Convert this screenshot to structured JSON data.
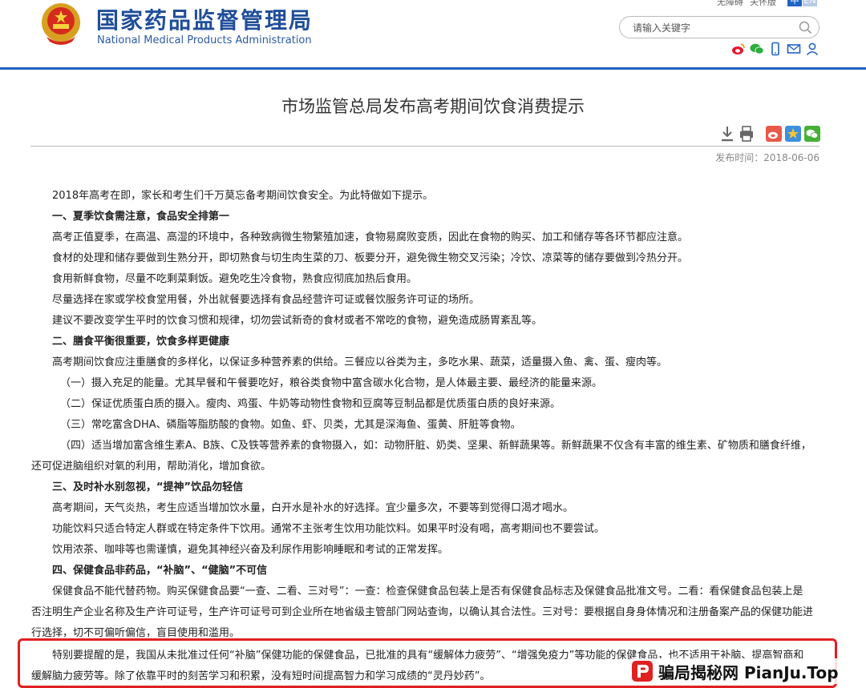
{
  "header": {
    "site_name_cn": "国家药品监督管理局",
    "site_name_en": "National Medical Products Administration",
    "util_links": [
      "无障碍",
      "关怀版"
    ],
    "lang_cn": "中",
    "lang_en": "EN",
    "search_placeholder": "请输入关键字",
    "social_icons": [
      "weibo-icon",
      "wechat-icon",
      "mobile-icon",
      "mail-icon",
      "user-icon"
    ]
  },
  "article": {
    "title": "市场监管总局发布高考期间饮食消费提示",
    "publish_time": "发布时间：2018-06-06",
    "paragraphs": [
      "2018年高考在即，家长和考生们千万莫忘备考期间饮食安全。为此特做如下提示。",
      "一、夏季饮食需注意，食品安全排第一",
      "高考正值夏季，在高温、高湿的环境中，各种致病微生物繁殖加速，食物易腐败变质，因此在食物的购买、加工和储存等各环节都应注意。",
      "食材的处理和储存要做到生熟分开，即切熟食与切生肉生菜的刀、板要分开，避免微生物交叉污染；冷饮、凉菜等的储存要做到冷热分开。",
      "食用新鲜食物，尽量不吃剩菜剩饭。避免吃生冷食物，熟食应彻底加热后食用。",
      "尽量选择在家或学校食堂用餐，外出就餐要选择有食品经营许可证或餐饮服务许可证的场所。",
      "建议不要改变学生平时的饮食习惯和规律，切勿尝试新奇的食材或者不常吃的食物，避免造成肠胃紊乱等。",
      "二、膳食平衡很重要，饮食多样更健康",
      "高考期间饮食应注重膳食的多样化，以保证多种营养素的供给。三餐应以谷类为主，多吃水果、蔬菜，适量摄入鱼、禽、蛋、瘦肉等。",
      "（一）摄入充足的能量。尤其早餐和午餐要吃好，粮谷类食物中富含碳水化合物，是人体最主要、最经济的能量来源。",
      "（二）保证优质蛋白质的摄入。瘦肉、鸡蛋、牛奶等动物性食物和豆腐等豆制品都是优质蛋白质的良好来源。",
      "（三）常吃富含DHA、磷脂等脂肪酸的食物。如鱼、虾、贝类，尤其是深海鱼、蛋黄、肝脏等食物。",
      "（四）适当增加富含维生素A、B族、C及铁等营养素的食物摄入，如：动物肝脏、奶类、坚果、新鲜蔬果等。新鲜蔬果不仅含有丰富的维生素、矿物质和膳食纤维，",
      "还可促进脑组织对氧的利用，帮助消化，增加食欲。",
      "三、及时补水别忽视，“提神”饮品勿轻信",
      "高考期间，天气炎热，考生应适当增加饮水量，白开水是补水的好选择。宜少量多次，不要等到觉得口渴才喝水。",
      "功能饮料只适合特定人群或在特定条件下饮用。通常不主张考生饮用功能饮料。如果平时没有喝，高考期间也不要尝试。",
      "饮用浓茶、咖啡等也需谨慎，避免其神经兴奋及利尿作用影响睡眠和考试的正常发挥。",
      "四、保健食品非药品，“补脑”、“健脑”不可信",
      "保健食品不能代替药物。购买保健食品要“一查、二看、三对号”：一查：检查保健食品包装上是否有保健食品标志及保健食品批准文号。二看：看保健食品包装上是",
      "否注明生产企业名称及生产许可证号，生产许可证号可到企业所在地省级主管部门网站查询，以确认其合法性。三对号：要根据自身身体情况和注册备案产品的保健功能进",
      "行选择，切不可偏听偏信，盲目使用和滥用。"
    ],
    "highlight": [
      "特别要提醒的是，我国从未批准过任何“补脑”保健功能的保健食品，已批准的具有“缓解体力疲劳”、“增强免疫力”等功能的保健食品，也不适用于补脑、提高智商和",
      "缓解脑力疲劳等。除了依靠平时的刻苦学习和积累，没有短时间提高智力和学习成绩的“灵丹妙药”。"
    ]
  },
  "watermark": {
    "text": "骗局揭秘网 PianJu.Top"
  },
  "colors": {
    "brand_blue": "#1f4e9a",
    "accent_blue": "#1f64c4",
    "highlight_red": "#e02020"
  }
}
